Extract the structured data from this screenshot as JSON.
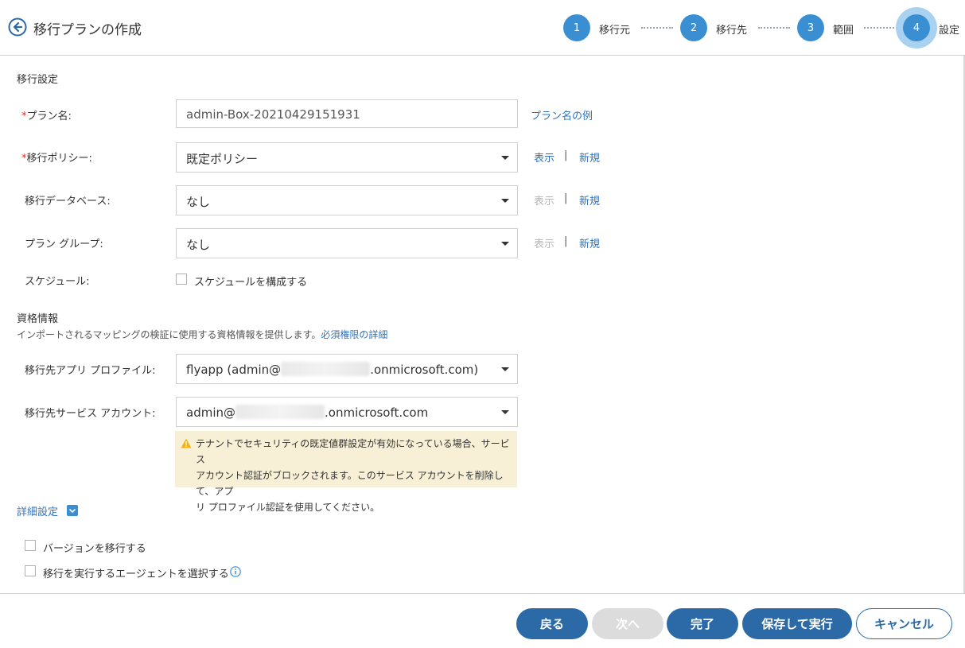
{
  "header": {
    "title": "移行プランの作成",
    "steps": [
      {
        "number": "1",
        "label": "移行元"
      },
      {
        "number": "2",
        "label": "移行先"
      },
      {
        "number": "3",
        "label": "範囲"
      },
      {
        "number": "4",
        "label": "設定"
      }
    ],
    "active_step": 4
  },
  "migration_settings": {
    "title": "移行設定",
    "plan_name": {
      "label": "プラン名:",
      "value": "admin-Box-20210429151931",
      "example_link": "プラン名の例"
    },
    "policy": {
      "label": "移行ポリシー:",
      "value": "既定ポリシー",
      "view": "表示",
      "new": "新規"
    },
    "database": {
      "label": "移行データベース:",
      "value": "なし",
      "view": "表示",
      "new": "新規"
    },
    "plan_group": {
      "label": "プラン グループ:",
      "value": "なし",
      "view": "表示",
      "new": "新規"
    },
    "schedule": {
      "label": "スケジュール:",
      "checkbox_label": "スケジュールを構成する"
    },
    "separator": "|",
    "required_mark": "*"
  },
  "credentials": {
    "title": "資格情報",
    "description": "インポートされるマッピングの検証に使用する資格情報を提供します。",
    "permissions_link": "必須権限の詳細",
    "app_profile": {
      "label": "移行先アプリ プロファイル:",
      "value_prefix": "flyapp (admin@",
      "value_suffix": ".onmicrosoft.com)"
    },
    "service_account": {
      "label": "移行先サービス アカウント:",
      "value_prefix": "admin@",
      "value_suffix": ".onmicrosoft.com"
    },
    "warning": {
      "line1": "テナントでセキュリティの既定値群設定が有効になっている場合、サービス",
      "line2": "アカウント認証がブロックされます。このサービス アカウントを削除して、アプ",
      "line3": "リ プロファイル認証を使用してください。"
    }
  },
  "advanced": {
    "title": "詳細設定",
    "options": [
      {
        "label": "バージョンを移行する",
        "checked": false
      },
      {
        "label": "移行を実行するエージェントを選択する",
        "checked": false
      }
    ]
  },
  "footer": {
    "back": "戻る",
    "next": "次へ",
    "finish": "完了",
    "save_run": "保存して実行",
    "cancel": "キャンセル"
  },
  "colors": {
    "accent": "#3a8fd2",
    "primary_button": "#2b6aa6",
    "link": "#2f74c0",
    "warning_bg": "#f8f0d6",
    "required": "#d0312d"
  }
}
